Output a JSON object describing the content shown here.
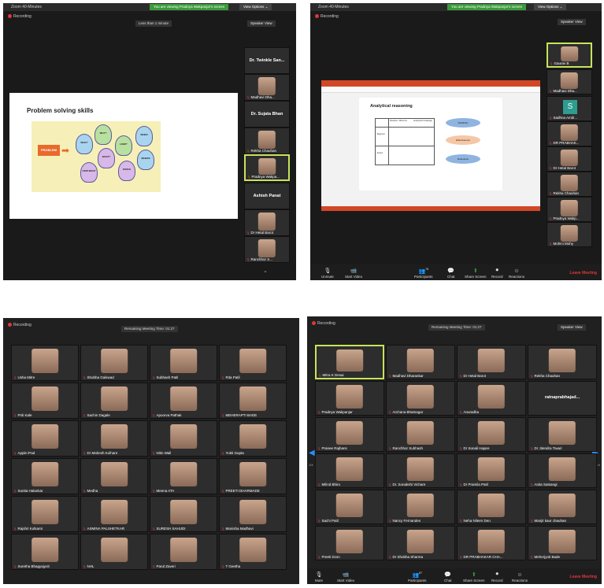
{
  "panel_tl": {
    "title": "Zoom 40-Minutes",
    "share_banner": "You are viewing Pradnya Wakpanjar's screen",
    "view_options": "View Options ⌄",
    "recording": "Recording",
    "timer": "Less than 1 minute",
    "speaker_view": "Speaker View",
    "slide_title": "Problem solving skills",
    "slide_box": "PROBLEM",
    "bulbs": [
      "WHO?",
      "WHY?",
      "HOW?",
      "WHEN",
      "WHERE",
      "WHAT?",
      "WHICH",
      "HOW MANY"
    ],
    "sidebar": [
      {
        "name": "Dr. Twinkle San...",
        "type": "text"
      },
      {
        "name": "Madhavi Dha...",
        "type": "photo"
      },
      {
        "name": "Dr. Sujata Bhan",
        "type": "text"
      },
      {
        "name": "Rekha Chauhan",
        "type": "photo"
      },
      {
        "name": "Pradnya Wakpa...",
        "type": "photo",
        "active": true
      },
      {
        "name": "Ashish Panat",
        "type": "text"
      },
      {
        "name": "Dr Hetal Barot",
        "type": "photo"
      },
      {
        "name": "Ranchhor S...",
        "type": "photo"
      }
    ]
  },
  "panel_tr": {
    "title": "Zoom 40-Minutes",
    "share_banner": "You are viewing Pradnya Wakpanjar's screen",
    "view_options": "View Options ⌄",
    "recording": "Recording",
    "speaker_view": "Speaker View",
    "slide_title": "Analytical reasoning",
    "table_headers": [
      "Situation / Dilemma",
      "Analytical Knowledge"
    ],
    "row_labels": [
      "Beginner",
      "Expert"
    ],
    "flow": [
      "Reliability",
      "Effectiveness",
      "Relevance"
    ],
    "sidebar": [
      {
        "name": "Gaurav B",
        "active": true
      },
      {
        "name": "Madhavi Dha..."
      },
      {
        "name": "Sadhna Ambl..."
      },
      {
        "name": "DR PRABHAK..."
      },
      {
        "name": "Dr Hetal Barot"
      },
      {
        "name": "Rekha Chauhan"
      },
      {
        "name": "Pradnya Wakp..."
      },
      {
        "name": "Mohini Mohy"
      }
    ],
    "toolbar": [
      "Unmute",
      "Start Video",
      "Participants",
      "Chat",
      "Share Screen",
      "Record",
      "Reactions"
    ],
    "participant_count": "78",
    "leave": "Leave Meeting"
  },
  "panel_bl": {
    "recording": "Recording",
    "timer": "Remaining Meeting Time: 01:27",
    "grid": [
      "Usha Mitre",
      "Shobha Gaikwad",
      "Subhash Patil",
      "Rita Patil",
      "Priti Kale",
      "Sachin Dagale",
      "Apoorva Pathak",
      "MEHERAPTI BADE",
      "Apple iPad",
      "Dr Mahesh Kolhare",
      "Nitin Wall",
      "Yukti Gupta",
      "Sunita Halankar",
      "Medha",
      "Meena ATA",
      "PREETI DHARMADE",
      "Rajshri Kulkarni",
      "ASMINA PALSHETKAR",
      "SURESH SAHUDI",
      "Manisha Madhavi",
      "Suretha Bhagyajyoti",
      "NHL",
      "Parul Zaveri",
      "T Geetha"
    ]
  },
  "panel_br": {
    "recording": "Recording",
    "timer": "Remaining Meeting Time: 01:27",
    "speaker_view": "Speaker View",
    "grid": [
      "Mitra K Desai",
      "Madhavi Dharankar",
      "Dr Hetal Barot",
      "Rekha Chauhan",
      "Pradnya Wakpanjar",
      "Archana Bhatnagar",
      "Anuradha",
      "ratnaprabhajad...",
      "Pranee Rajhans",
      "Ranchhor Subhash",
      "Dr Sonali Hajare",
      "Dr Jitendra Tiwari",
      "Milind Bhiro",
      "Dr. Sonakshi Vichare",
      "Dr Pramila Patil",
      "Anita Satsangi",
      "Sachi Patil",
      "Nancy Fernandes",
      "Neha Nileen Deo",
      "Manjit kaur chauhan",
      "Preeti Dcsn",
      "Dr Shobha Sharma",
      "DR PRABHAKAR CHA...",
      "Meherjyoti Bade"
    ],
    "page_left": "1/4",
    "page_right": "1/4",
    "toolbar": [
      "Mute",
      "Start Video",
      "Participants",
      "Chat",
      "Share Screen",
      "Record",
      "Reactions"
    ],
    "participant_count": "87",
    "leave": "Leave Meeting"
  },
  "colors": {
    "accent_green": "#3c9a3c",
    "active_border": "#c7e45a",
    "leave_red": "#e23636",
    "ppt_orange": "#d24726"
  }
}
